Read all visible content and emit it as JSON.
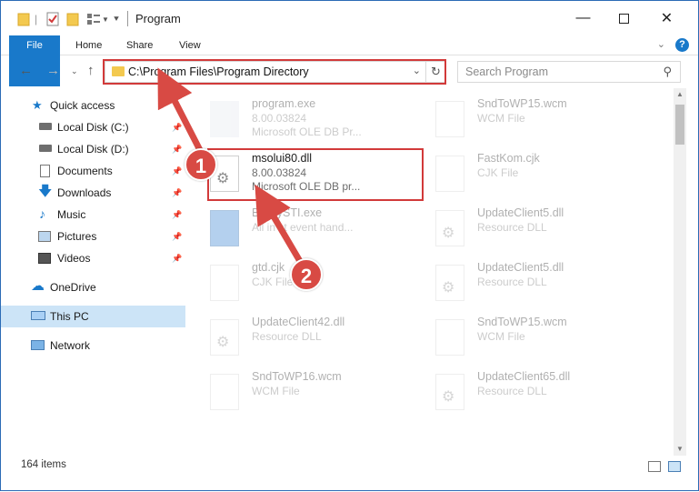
{
  "window": {
    "title": "Program",
    "colors": {
      "accent": "#1979ca",
      "highlight": "#d23a3a",
      "selected": "#cce4f7",
      "badge": "#d84a44"
    }
  },
  "ribbon": {
    "tabs": [
      "File",
      "Home",
      "Share",
      "View"
    ]
  },
  "address": {
    "path": "C:\\Program Files\\Program Directory",
    "search_placeholder": "Search Program"
  },
  "sidebar": {
    "quick_access": "Quick access",
    "items": [
      {
        "label": "Local Disk (C:)",
        "icon": "drive-icon"
      },
      {
        "label": "Local Disk (D:)",
        "icon": "drive-icon"
      },
      {
        "label": "Documents",
        "icon": "documents-icon"
      },
      {
        "label": "Downloads",
        "icon": "downloads-icon"
      },
      {
        "label": "Music",
        "icon": "music-icon"
      },
      {
        "label": "Pictures",
        "icon": "pictures-icon"
      },
      {
        "label": "Videos",
        "icon": "videos-icon"
      }
    ],
    "onedrive": "OneDrive",
    "this_pc": "This PC",
    "network": "Network"
  },
  "files": {
    "left": [
      {
        "name": "program.exe",
        "line2": "8.00.03824",
        "line3": "Microsoft OLE DB Pr..."
      },
      {
        "name": "msolui80.dll",
        "line2": "8.00.03824",
        "line3": "Microsoft OLE DB pr..."
      },
      {
        "name": "BossySTI.exe",
        "line2": "All in st event hand..."
      },
      {
        "name": "gtd.cjk",
        "line2": "CJK File"
      },
      {
        "name": "UpdateClient42.dll",
        "line2": "Resource DLL"
      },
      {
        "name": "SndToWP16.wcm",
        "line2": "WCM File"
      }
    ],
    "right": [
      {
        "name": "SndToWP15.wcm",
        "line2": "WCM File"
      },
      {
        "name": "FastKom.cjk",
        "line2": "CJK File"
      },
      {
        "name": "UpdateClient5.dll",
        "line2": "Resource DLL"
      },
      {
        "name": "UpdateClient5.dll",
        "line2": "Resource DLL"
      },
      {
        "name": "SndToWP15.wcm",
        "line2": "WCM File"
      },
      {
        "name": "UpdateClient65.dll",
        "line2": "Resource DLL"
      }
    ]
  },
  "status": {
    "items": "164 items"
  },
  "annotations": {
    "step1": "1",
    "step2": "2"
  }
}
